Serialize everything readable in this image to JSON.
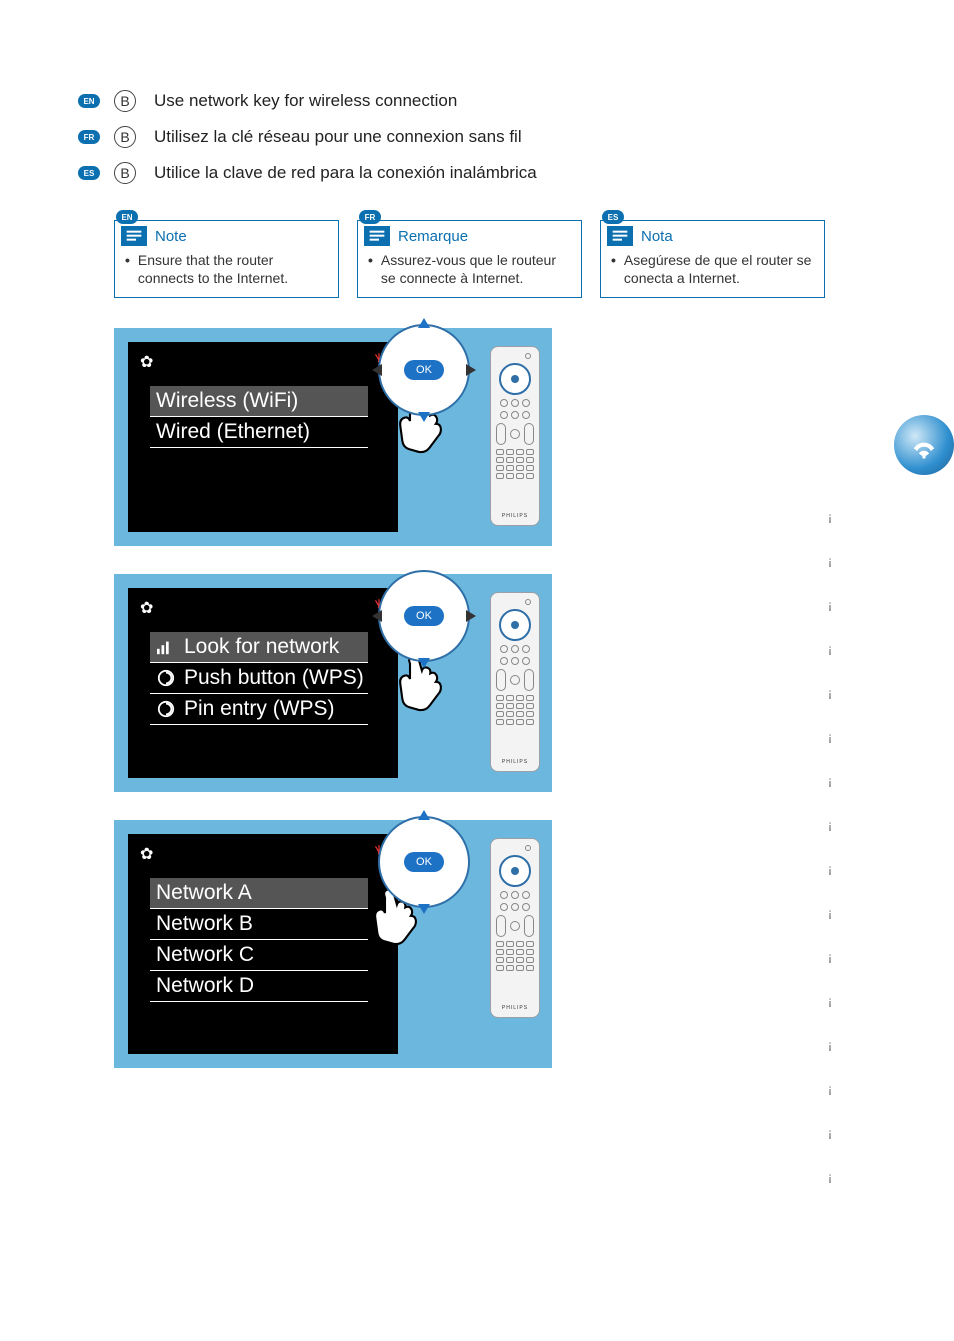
{
  "step_letter": "B",
  "languages": {
    "en": {
      "code": "EN",
      "text": "Use network key for wireless connection"
    },
    "fr": {
      "code": "FR",
      "text": "Utilisez la clé réseau pour une connexion sans fil"
    },
    "es": {
      "code": "ES",
      "text": "Utilice la clave de red para la conexión inalámbrica"
    }
  },
  "notes": {
    "en": {
      "code": "EN",
      "title": "Note",
      "body": "Ensure that the router connects to the Internet."
    },
    "fr": {
      "code": "FR",
      "title": "Remarque",
      "body": "Assurez-vous que le routeur se connecte à Internet."
    },
    "es": {
      "code": "ES",
      "title": "Nota",
      "body": "Asegúrese de que el router se conecta a Internet."
    }
  },
  "dpad": {
    "ok_label": "OK"
  },
  "remote": {
    "brand": "PHILIPS"
  },
  "screen1": {
    "options": [
      {
        "label": "Wireless (WiFi)",
        "selected": true
      },
      {
        "label": "Wired (Ethernet)",
        "selected": false
      }
    ]
  },
  "screen2": {
    "options": [
      {
        "label": "Look for network",
        "selected": true,
        "icon": "signal"
      },
      {
        "label": "Push button (WPS)",
        "selected": false,
        "icon": "wps"
      },
      {
        "label": "Pin entry (WPS)",
        "selected": false,
        "icon": "wps"
      }
    ]
  },
  "screen3": {
    "options": [
      {
        "label": "Network A",
        "selected": true
      },
      {
        "label": "Network B",
        "selected": false
      },
      {
        "label": "Network C",
        "selected": false
      },
      {
        "label": "Network D",
        "selected": false
      }
    ]
  }
}
